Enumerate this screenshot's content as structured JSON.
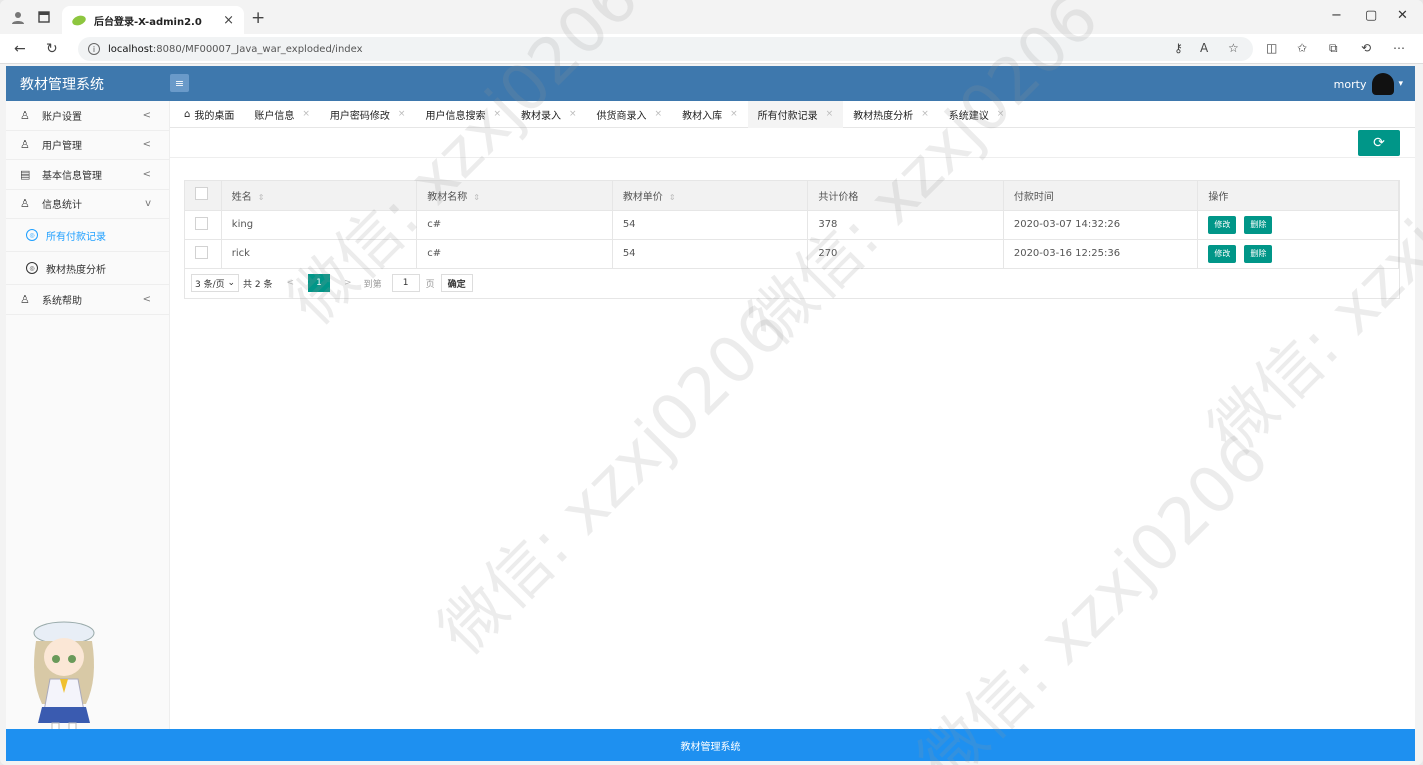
{
  "browser": {
    "tab_title": "后台登录-X-admin2.0",
    "tab_close": "×",
    "new_tab": "+",
    "url_host": "localhost",
    "url_rest": ":8080/MF00007_Java_war_exploded/index",
    "min": "−",
    "restore": "▢",
    "close": "✕"
  },
  "header": {
    "logo": "教材管理系统",
    "menu_icon": "≡",
    "username": "morty",
    "caret": "▾"
  },
  "sidebar": {
    "items": [
      {
        "label": "账户设置",
        "arrow": "<"
      },
      {
        "label": "用户管理",
        "arrow": "<"
      },
      {
        "label": "基本信息管理",
        "arrow": "<"
      },
      {
        "label": "信息统计",
        "arrow": "v"
      }
    ],
    "sub_items": [
      {
        "label": "所有付款记录"
      },
      {
        "label": "教材热度分析"
      }
    ],
    "last": {
      "label": "系统帮助",
      "arrow": "<"
    }
  },
  "tabs": [
    {
      "label": "我的桌面",
      "close": ""
    },
    {
      "label": "账户信息",
      "close": "×"
    },
    {
      "label": "用户密码修改",
      "close": "×"
    },
    {
      "label": "用户信息搜索",
      "close": "×"
    },
    {
      "label": "教材录入",
      "close": "×"
    },
    {
      "label": "供货商录入",
      "close": "×"
    },
    {
      "label": "教材入库",
      "close": "×"
    },
    {
      "label": "所有付款记录",
      "close": "×"
    },
    {
      "label": "教材热度分析",
      "close": "×"
    },
    {
      "label": "系统建议",
      "close": "×"
    }
  ],
  "refresh_icon": "⟳",
  "table": {
    "headers": [
      "姓名",
      "教材名称",
      "教材单价",
      "共计价格",
      "付款时间",
      "操作"
    ],
    "sort_icon": "⇕",
    "rows": [
      {
        "name": "king",
        "book": "c#",
        "price": "54",
        "total": "378",
        "time": "2020-03-07 14:32:26"
      },
      {
        "name": "rick",
        "book": "c#",
        "price": "54",
        "total": "270",
        "time": "2020-03-16 12:25:36"
      }
    ],
    "edit_label": "修改",
    "delete_label": "删除"
  },
  "pager": {
    "per_page": "3 条/页",
    "per_page_arrow": "⌄",
    "total": "共 2 条",
    "prev": "<",
    "current": "1",
    "next": ">",
    "goto_label": "到第",
    "goto_value": "1",
    "page_label": "页",
    "confirm": "确定"
  },
  "footer": "教材管理系统",
  "watermark": "微信: xzxj0206"
}
